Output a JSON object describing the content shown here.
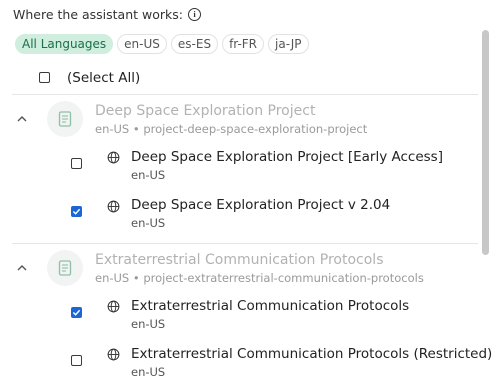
{
  "heading": "Where the assistant works:",
  "language_filters": [
    "All Languages",
    "en-US",
    "es-ES",
    "fr-FR",
    "ja-JP"
  ],
  "select_all_label": "(Select All)",
  "groups": [
    {
      "title": "Deep Space Exploration Project",
      "subtitle": "en-US • project-deep-space-exploration-project",
      "items": [
        {
          "title": "Deep Space Exploration Project [Early Access]",
          "locale": "en-US",
          "checked": false
        },
        {
          "title": "Deep Space Exploration Project v 2.04",
          "locale": "en-US",
          "checked": true
        }
      ]
    },
    {
      "title": "Extraterrestrial Communication Protocols",
      "subtitle": "en-US • project-extraterrestrial-communication-protocols",
      "items": [
        {
          "title": "Extraterrestrial Communication Protocols",
          "locale": "en-US",
          "checked": true
        },
        {
          "title": "Extraterrestrial Communication Protocols (Restricted)",
          "locale": "en-US",
          "checked": false
        }
      ]
    }
  ],
  "colors": {
    "accent": "#1a66d6",
    "chip_active_bg": "#cfeede",
    "chip_active_text": "#1d6e4a",
    "group_title": "#b2b2b2"
  },
  "icons": {
    "info": "info-circle-icon",
    "collapse": "chevron-up-icon",
    "group": "document-icon",
    "item": "globe-icon"
  }
}
